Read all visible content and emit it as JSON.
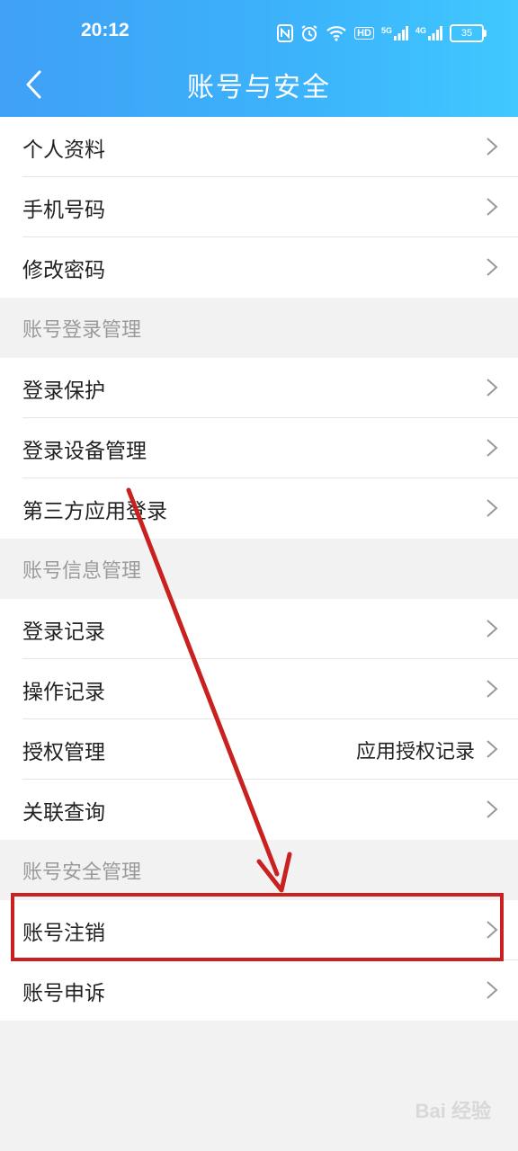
{
  "status_bar": {
    "time": "20:12",
    "icons": [
      "nfc-icon",
      "alarm-icon",
      "wifi-icon",
      "hd-icon",
      "5g-signal-icon",
      "4g-signal-icon"
    ],
    "hd": "HD",
    "sig5g": "5G",
    "sig4g": "4G",
    "battery": "35"
  },
  "header": {
    "title": "账号与安全",
    "back_icon": "chevron-left-icon"
  },
  "groups": {
    "basic": [
      {
        "label": "个人资料"
      },
      {
        "label": "手机号码"
      },
      {
        "label": "修改密码"
      }
    ],
    "login_mgmt": {
      "title": "账号登录管理",
      "items": [
        {
          "label": "登录保护"
        },
        {
          "label": "登录设备管理"
        },
        {
          "label": "第三方应用登录"
        }
      ]
    },
    "info_mgmt": {
      "title": "账号信息管理",
      "items": [
        {
          "label": "登录记录"
        },
        {
          "label": "操作记录"
        },
        {
          "label": "授权管理",
          "value": "应用授权记录"
        },
        {
          "label": "关联查询"
        }
      ]
    },
    "security_mgmt": {
      "title": "账号安全管理",
      "items": [
        {
          "label": "账号注销"
        },
        {
          "label": "账号申诉"
        }
      ]
    }
  },
  "annotation": {
    "color": "#c8211f"
  },
  "watermark": {
    "text": "Bai 经验"
  },
  "colors": {
    "header_start": "#3fa0f5",
    "header_end": "#40c8ff",
    "background": "#f2f2f2"
  }
}
